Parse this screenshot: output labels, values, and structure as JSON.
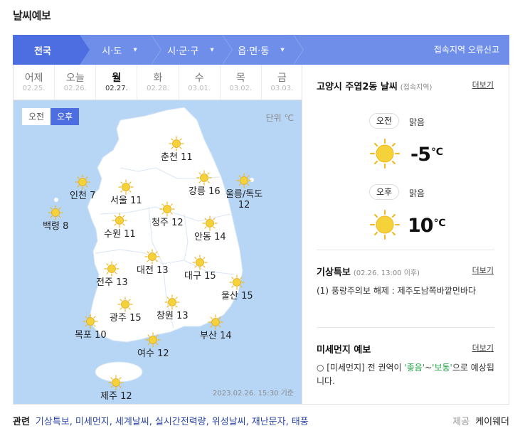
{
  "page": {
    "title": "날씨예보"
  },
  "region_bar": {
    "steps": [
      {
        "label": "전국"
      },
      {
        "label": "시·도"
      },
      {
        "label": "시·군·구"
      },
      {
        "label": "읍·면·동"
      }
    ],
    "report_label": "접속지역 오류신고"
  },
  "days": [
    {
      "name": "어제",
      "date": "02.25."
    },
    {
      "name": "오늘",
      "date": "02.26."
    },
    {
      "name": "월",
      "date": "02.27."
    },
    {
      "name": "화",
      "date": "02.28."
    },
    {
      "name": "수",
      "date": "03.01."
    },
    {
      "name": "목",
      "date": "03.02."
    },
    {
      "name": "금",
      "date": "03.03."
    }
  ],
  "active_day_index": 2,
  "map": {
    "am_label": "오전",
    "pm_label": "오후",
    "unit_label": "단위 ℃",
    "base_time": "2023.02.26. 15:30 기준",
    "icon": "sun-icon",
    "cities": [
      {
        "name": "춘천",
        "temp": "11"
      },
      {
        "name": "인천",
        "temp": "7"
      },
      {
        "name": "서울",
        "temp": "11"
      },
      {
        "name": "강릉",
        "temp": "16"
      },
      {
        "name": "울릉/독도",
        "temp": "12"
      },
      {
        "name": "백령",
        "temp": "8"
      },
      {
        "name": "청주",
        "temp": "12"
      },
      {
        "name": "수원",
        "temp": "11"
      },
      {
        "name": "안동",
        "temp": "14"
      },
      {
        "name": "대전",
        "temp": "13"
      },
      {
        "name": "대구",
        "temp": "15"
      },
      {
        "name": "전주",
        "temp": "13"
      },
      {
        "name": "울산",
        "temp": "15"
      },
      {
        "name": "광주",
        "temp": "15"
      },
      {
        "name": "창원",
        "temp": "13"
      },
      {
        "name": "목포",
        "temp": "10"
      },
      {
        "name": "부산",
        "temp": "14"
      },
      {
        "name": "여수",
        "temp": "12"
      },
      {
        "name": "제주",
        "temp": "12"
      }
    ]
  },
  "local": {
    "title": "고양시 주엽2동 날씨",
    "subtitle": "(접속지역)",
    "more": "더보기",
    "am": {
      "label": "오전",
      "condition": "맑음",
      "temp": "-5",
      "unit": "℃",
      "icon": "sun-icon"
    },
    "pm": {
      "label": "오후",
      "condition": "맑음",
      "temp": "10",
      "unit": "℃",
      "icon": "sun-icon"
    }
  },
  "alert": {
    "title": "기상특보",
    "subtitle": "(02.26. 13:00 이후)",
    "more": "더보기",
    "text": "(1) 풍랑주의보 해제 : 제주도남쪽바깥먼바다"
  },
  "dust": {
    "title": "미세먼지 예보",
    "more": "더보기",
    "text_prefix": "○ [미세먼지] 전 권역이 ",
    "good": "'좋음'",
    "tilde": "~",
    "normal": "'보통'",
    "text_suffix": "으로 예상됩니다."
  },
  "footer": {
    "related_title": "관련",
    "links": [
      "기상특보",
      "미세먼지",
      "세계날씨",
      "실시간전력량",
      "위성날씨",
      "재난문자",
      "태풍"
    ],
    "provider_label": "제공",
    "provider_name": "케이웨더"
  },
  "colors": {
    "primary": "#4d6ee0",
    "bar": "#6e8ee9",
    "map_sea": "#b7d6f6",
    "map_land": "#ffffff",
    "sun": "#f5d23a",
    "link": "#2c46a8"
  }
}
